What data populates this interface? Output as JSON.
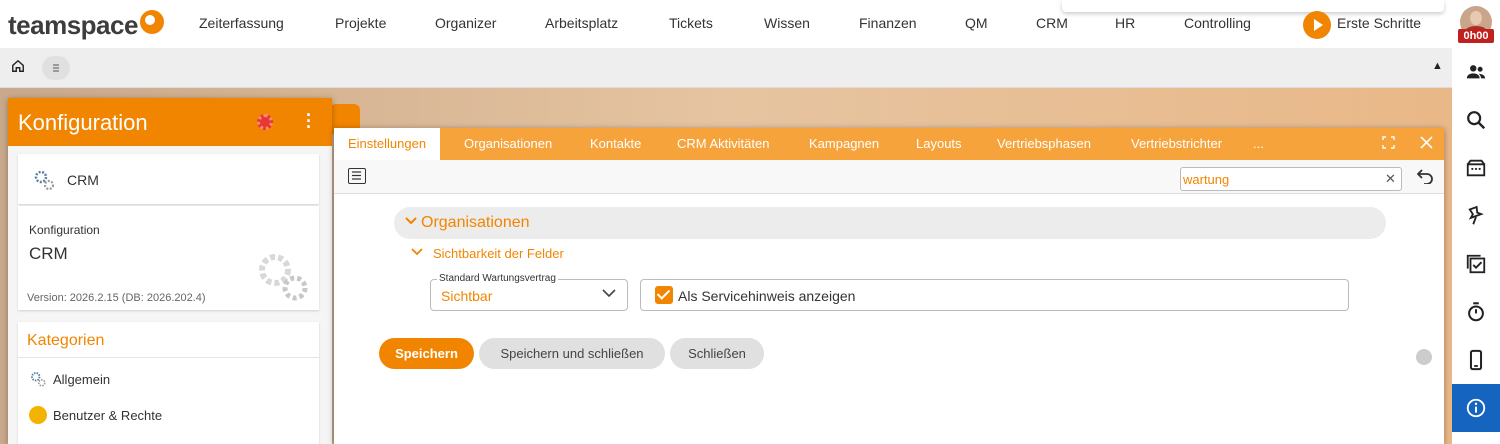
{
  "topbar": {
    "logo": "teamspace",
    "nav": [
      "Zeiterfassung",
      "Projekte",
      "Organizer",
      "Arbeitsplatz",
      "Tickets",
      "Wissen",
      "Finanzen",
      "QM",
      "CRM",
      "HR",
      "Controlling"
    ],
    "erste_schritte": "Erste Schritte"
  },
  "rightbar": {
    "time_badge": "0h00",
    "icons": [
      "contacts-icon",
      "search-icon",
      "inbox-icon",
      "pin-icon",
      "tasks-icon",
      "stopwatch-icon",
      "mobile-icon",
      "info-icon"
    ]
  },
  "config_panel": {
    "title": "Konfiguration",
    "module": "CRM",
    "info_label": "Konfiguration",
    "info_value": "CRM",
    "version": "Version: 2026.2.15 (DB: 2026.202.4)",
    "kategorien_title": "Kategorien",
    "kategorien": [
      "Allgemein",
      "Benutzer & Rechte"
    ]
  },
  "main": {
    "tabs": [
      "Einstellungen",
      "Organisationen",
      "Kontakte",
      "CRM Aktivitäten",
      "Kampagnen",
      "Layouts",
      "Vertriebsphasen",
      "Vertriebstrichter",
      "..."
    ],
    "search_value": "wartung",
    "section_title": "Organisationen",
    "subsection_title": "Sichtbarkeit der Felder",
    "field_label": "Standard Wartungsvertrag",
    "field_value": "Sichtbar",
    "checkbox_label": "Als Servicehinweis anzeigen",
    "btn_save": "Speichern",
    "btn_save_close": "Speichern und schließen",
    "btn_close": "Schließen"
  },
  "colors": {
    "accent": "#f28500",
    "tabbar": "#f7a33b",
    "info_blue": "#1565c0"
  }
}
